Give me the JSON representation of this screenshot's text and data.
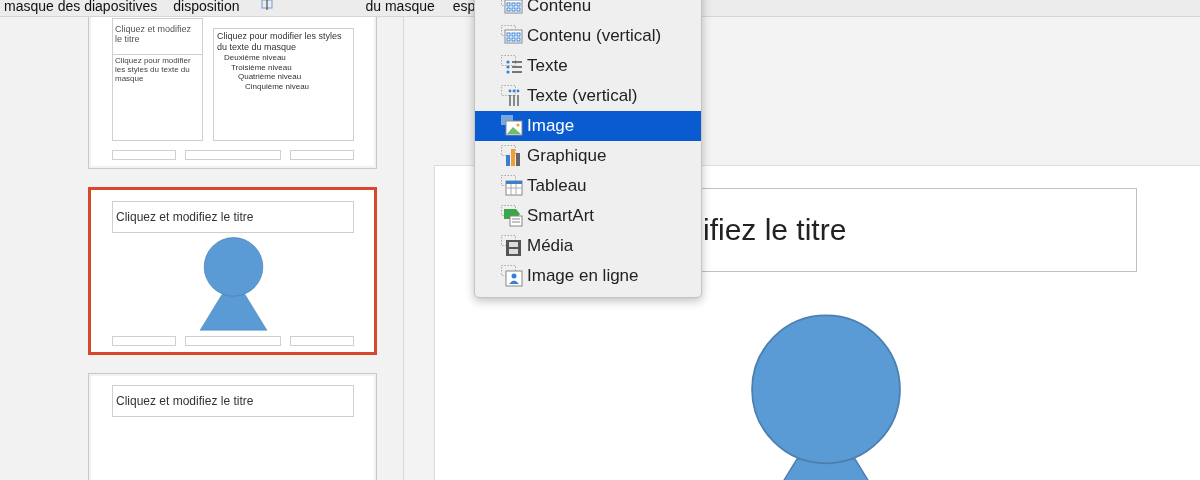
{
  "toolbar": {
    "items": [
      {
        "label": "masque des diapositives",
        "kind": "text"
      },
      {
        "label": "disposition",
        "kind": "text"
      },
      {
        "kind": "icon"
      },
      {
        "label": "du masque",
        "kind": "text"
      },
      {
        "label": "esp",
        "kind": "text"
      }
    ]
  },
  "slides": [
    {
      "kind": "two-content",
      "selected": false,
      "title": "Cliquez et modifiez le titre",
      "body": "Cliquez pour modifier les styles du texte du masque",
      "outline": [
        {
          "text": "Cliquez pour modifier les styles du texte du masque",
          "children": [
            {
              "text": "Deuxième niveau",
              "children": [
                {
                  "text": "Troisième niveau",
                  "children": [
                    {
                      "text": "Quatrième niveau",
                      "children": [
                        {
                          "text": "Cinquième niveau"
                        }
                      ]
                    }
                  ]
                }
              ]
            }
          ]
        }
      ]
    },
    {
      "kind": "picture-placeholder",
      "selected": true,
      "title": "Cliquez et modifiez le titre"
    },
    {
      "kind": "title-only",
      "selected": false,
      "title": "Cliquez et modifiez le titre"
    }
  ],
  "editor": {
    "title": "ifiez le titre"
  },
  "menu": {
    "items": [
      {
        "label": "Contenu",
        "kind": "content",
        "selected": false
      },
      {
        "label": "Contenu (vertical)",
        "kind": "content-vertical",
        "selected": false
      },
      {
        "label": "Texte",
        "kind": "text",
        "selected": false
      },
      {
        "label": "Texte (vertical)",
        "kind": "text-vertical",
        "selected": false
      },
      {
        "label": "Image",
        "kind": "image",
        "selected": true
      },
      {
        "label": "Graphique",
        "kind": "chart",
        "selected": false
      },
      {
        "label": "Tableau",
        "kind": "table",
        "selected": false
      },
      {
        "label": "SmartArt",
        "kind": "smartart",
        "selected": false
      },
      {
        "label": "Média",
        "kind": "media",
        "selected": false
      },
      {
        "label": "Image en ligne",
        "kind": "online-image",
        "selected": false
      }
    ]
  }
}
